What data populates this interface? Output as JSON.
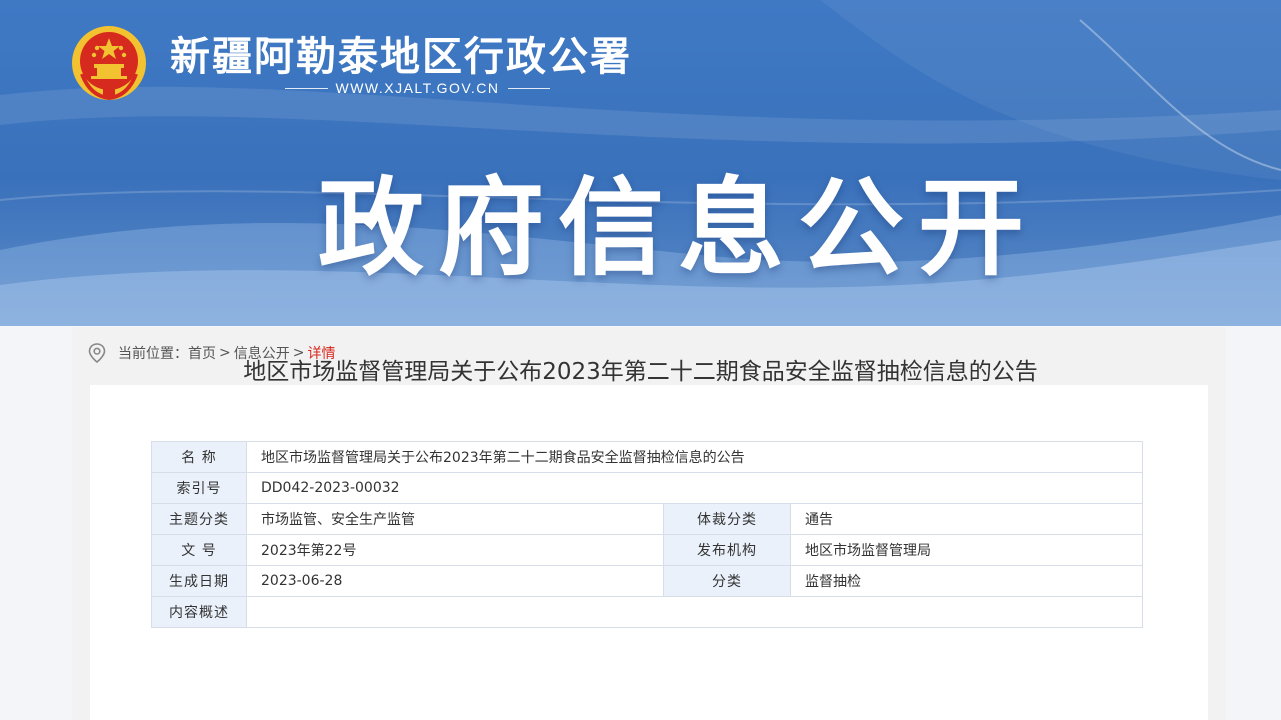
{
  "header": {
    "site_name": "新疆阿勒泰地区行政公署",
    "site_url": "WWW.XJALT.GOV.CN",
    "banner_title": "政府信息公开"
  },
  "breadcrumb": {
    "prefix": "当前位置：",
    "items": [
      "首页",
      "信息公开"
    ],
    "separator": ">",
    "current": "详情"
  },
  "info_table": {
    "name_label": "名 称",
    "name_value": "地区市场监督管理局关于公布2023年第二十二期食品安全监督抽检信息的公告",
    "index_label": "索引号",
    "index_value": "DD042-2023-00032",
    "topic_label": "主题分类",
    "topic_value": "市场监管、安全生产监管",
    "genre_label": "体裁分类",
    "genre_value": "通告",
    "doc_no_label": "文 号",
    "doc_no_value": "2023年第22号",
    "publisher_label": "发布机构",
    "publisher_value": "地区市场监督管理局",
    "date_label": "生成日期",
    "date_value": "2023-06-28",
    "category_label": "分类",
    "category_value": "监督抽检",
    "summary_label": "内容概述",
    "summary_value": ""
  },
  "article": {
    "title": "地区市场监督管理局关于公布2023年第二十二期食品安全监督抽检信息的公告"
  },
  "colors": {
    "banner_blue": "#3a71bb",
    "label_bg": "#eaf1fa",
    "current_red": "#d9261c",
    "emblem_red": "#d62a1f",
    "emblem_gold": "#f2c230"
  }
}
